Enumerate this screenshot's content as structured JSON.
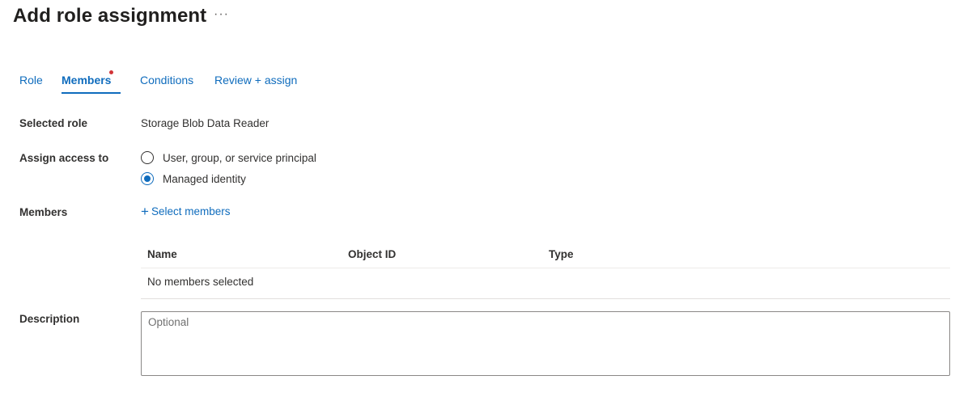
{
  "header": {
    "title": "Add role assignment",
    "more_label": "···"
  },
  "tabs": [
    {
      "label": "Role"
    },
    {
      "label": "Members",
      "active": true,
      "required_indicator": true
    },
    {
      "label": "Conditions"
    },
    {
      "label": "Review + assign"
    }
  ],
  "form": {
    "selected_role": {
      "label": "Selected role",
      "value": "Storage Blob Data Reader"
    },
    "assign_access_to": {
      "label": "Assign access to",
      "options": [
        {
          "label": "User, group, or service principal",
          "checked": false
        },
        {
          "label": "Managed identity",
          "checked": true
        }
      ]
    },
    "members": {
      "label": "Members",
      "select_link": "Select members",
      "table": {
        "columns": [
          "Name",
          "Object ID",
          "Type"
        ],
        "empty_text": "No members selected"
      }
    },
    "description": {
      "label": "Description",
      "placeholder": "Optional",
      "value": ""
    }
  },
  "colors": {
    "accent": "#0f6cbd",
    "required_dot": "#d13438",
    "text": "#323130",
    "border": "#8a8886"
  },
  "icons": [
    "more-icon",
    "plus-icon",
    "radio-unchecked-icon",
    "radio-checked-icon"
  ]
}
